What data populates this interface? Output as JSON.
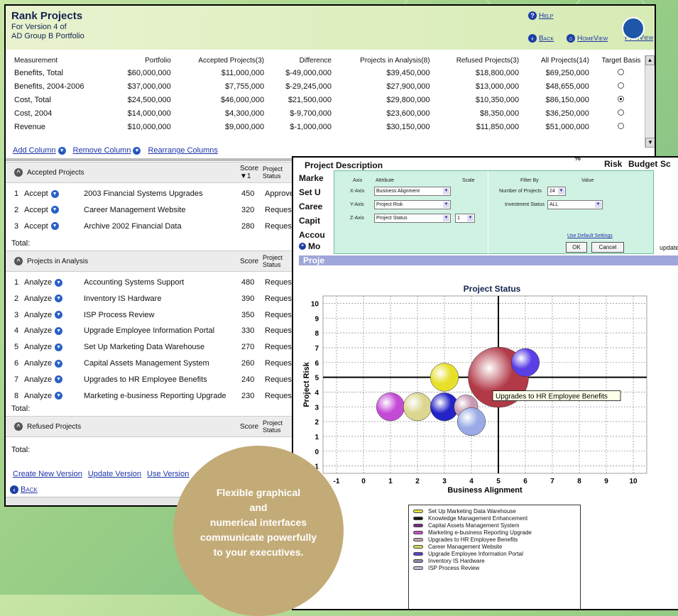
{
  "rank_window": {
    "title": "Rank Projects",
    "subtitle_line1": "For Version 4 of",
    "subtitle_line2": "AD Group B Portfolio",
    "help": "Help",
    "back": "Back",
    "homeview": "HomeView",
    "planview": "PlanView",
    "measurements": {
      "columns": [
        "Measurement",
        "Portfolio",
        "Accepted Projects(3)",
        "Difference",
        "Projects in Analysis(8)",
        "Refused Projects(3)",
        "All Projects(14)",
        "Target Basis"
      ],
      "rows": [
        {
          "name": "Benefits, Total",
          "portfolio": "$60,000,000",
          "accepted": "$11,000,000",
          "difference": "$-49,000,000",
          "analysis": "$39,450,000",
          "refused": "$18,800,000",
          "all": "$69,250,000",
          "target": false
        },
        {
          "name": "Benefits, 2004-2006",
          "portfolio": "$37,000,000",
          "accepted": "$7,755,000",
          "difference": "$-29,245,000",
          "analysis": "$27,900,000",
          "refused": "$13,000,000",
          "all": "$48,655,000",
          "target": false
        },
        {
          "name": "Cost, Total",
          "portfolio": "$24,500,000",
          "accepted": "$46,000,000",
          "difference": "$21,500,000",
          "analysis": "$29,800,000",
          "refused": "$10,350,000",
          "all": "$86,150,000",
          "target": true
        },
        {
          "name": "Cost, 2004",
          "portfolio": "$14,000,000",
          "accepted": "$4,300,000",
          "difference": "$-9,700,000",
          "analysis": "$23,600,000",
          "refused": "$8,350,000",
          "all": "$36,250,000",
          "target": false
        },
        {
          "name": "Revenue",
          "portfolio": "$10,000,000",
          "accepted": "$9,000,000",
          "difference": "$-1,000,000",
          "analysis": "$30,150,000",
          "refused": "$11,850,000",
          "all": "$51,000,000",
          "target": false
        }
      ]
    },
    "column_links": {
      "add": "Add Column",
      "remove": "Remove Column",
      "rearrange": "Rearrange Columns"
    },
    "accepted": {
      "header": "Accepted Projects",
      "score_label": "Score",
      "status_label_1": "Project",
      "status_label_2": "Status",
      "rows": [
        {
          "num": "1",
          "action": "Accept",
          "name": "2003 Financial Systems Upgrades",
          "score": "450",
          "status": "Approved"
        },
        {
          "num": "2",
          "action": "Accept",
          "name": "Career Management Website",
          "score": "320",
          "status": "Requested"
        },
        {
          "num": "3",
          "action": "Accept",
          "name": "Archive 2002 Financial Data",
          "score": "280",
          "status": "Requested"
        }
      ],
      "total": "Total:"
    },
    "analysis": {
      "header": "Projects in Analysis",
      "score_label": "Score",
      "status_label_1": "Project",
      "status_label_2": "Status",
      "rows": [
        {
          "num": "1",
          "action": "Analyze",
          "name": "Accounting Systems Support",
          "score": "480",
          "status": "Requested"
        },
        {
          "num": "2",
          "action": "Analyze",
          "name": "Inventory IS Hardware",
          "score": "390",
          "status": "Requested"
        },
        {
          "num": "3",
          "action": "Analyze",
          "name": "ISP Process Review",
          "score": "350",
          "status": "Requested"
        },
        {
          "num": "4",
          "action": "Analyze",
          "name": "Upgrade Employee Information Portal",
          "score": "330",
          "status": "Requested"
        },
        {
          "num": "5",
          "action": "Analyze",
          "name": "Set Up Marketing Data Warehouse",
          "score": "270",
          "status": "Requested"
        },
        {
          "num": "6",
          "action": "Analyze",
          "name": "Capital Assets Management System",
          "score": "260",
          "status": "Requested"
        },
        {
          "num": "7",
          "action": "Analyze",
          "name": "Upgrades to HR Employee Benefits",
          "score": "240",
          "status": "Requested"
        },
        {
          "num": "8",
          "action": "Analyze",
          "name": "Marketing e-business Reporting Upgrade",
          "score": "230",
          "status": "Requested"
        }
      ],
      "total": "Total:"
    },
    "refused": {
      "header": "Refused Projects",
      "score_label": "Score",
      "status_label_1": "Project",
      "status_label_2": "Status",
      "total": "Total:"
    },
    "bottom_links": {
      "create": "Create New Version",
      "update": "Update Version",
      "use": "Use Version"
    },
    "bottom_back": "Back"
  },
  "chart_window": {
    "col_project_description": "Project Description",
    "col_pct": "%",
    "col_risk": "Risk",
    "col_budget": "Budget",
    "col_sc": "Sc",
    "left_labels": [
      "Marke",
      "Set U",
      "Caree",
      "Capit",
      "Accou",
      "Mo"
    ],
    "bar_label": "Proje",
    "update_text": "update",
    "filter": {
      "axis_hdr": "Axis",
      "attr_hdr": "Attribute",
      "scale_hdr": "Scale",
      "x_axis": "X-Axis",
      "x_attr": "Business Alignment",
      "y_axis": "Y-Axis",
      "y_attr": "Project Risk",
      "z_axis": "Z-Axis",
      "z_attr": "Project Status",
      "z_scale": "1",
      "filterby_hdr": "Filter By",
      "value_hdr": "Value",
      "num_projects_label": "Number of Projects",
      "num_projects": "24",
      "inv_status_label": "Investment Status",
      "inv_status": "ALL",
      "default_link": "Use Default Settings",
      "ok": "OK",
      "cancel": "Cancel"
    },
    "tooltip": "Upgrades to HR Employee Benefits",
    "legend_items": [
      {
        "label": "Set Up Marketing Data Warehouse",
        "color": "#e8e23a"
      },
      {
        "label": "Knowledge Management Enhancement",
        "color": "#1a1a1a"
      },
      {
        "label": "Capital Assets Management System",
        "color": "#7a2a82"
      },
      {
        "label": "Marketing e-business Reporting Upgrade",
        "color": "#c850c8"
      },
      {
        "label": "Upgrades to HR Employee Benefits",
        "color": "#c8a0b4"
      },
      {
        "label": "Career Management Website",
        "color": "#d8d860"
      },
      {
        "label": "Upgrade Employee Information Portal",
        "color": "#5a3ed6"
      },
      {
        "label": "Inventory IS Hardware",
        "color": "#8c8caa"
      },
      {
        "label": "ISP Process Review",
        "color": "#b4c0d8"
      }
    ]
  },
  "chart_data": {
    "type": "scatter",
    "title": "Project Status",
    "xlabel": "Business Alignment",
    "ylabel": "Project Risk",
    "xlim": [
      -1.5,
      10.5
    ],
    "ylim": [
      -1.5,
      10.5
    ],
    "xticks": [
      "-1",
      "0",
      "1",
      "2",
      "3",
      "4",
      "5",
      "6",
      "7",
      "8",
      "9",
      "10"
    ],
    "yticks": [
      "10",
      "9",
      "8",
      "7",
      "6",
      "5",
      "4",
      "3",
      "2",
      "1",
      "0",
      "-1"
    ],
    "crosshair": {
      "x": 5,
      "y": 5
    },
    "grid": true,
    "points": [
      {
        "x": 1,
        "y": 3,
        "z": 1.0,
        "color": "#c44bd6"
      },
      {
        "x": 2,
        "y": 3,
        "z": 1.0,
        "color": "#dcd690"
      },
      {
        "x": 3,
        "y": 5,
        "z": 1.0,
        "color": "#e6e02a"
      },
      {
        "x": 3,
        "y": 3,
        "z": 1.0,
        "color": "#2323c8"
      },
      {
        "x": 3.8,
        "y": 3,
        "z": 0.85,
        "color": "#c89ab4"
      },
      {
        "x": 4,
        "y": 2,
        "z": 1.0,
        "color": "#9aaae6"
      },
      {
        "x": 5,
        "y": 5,
        "z": 2.15,
        "color": "#b23a48"
      },
      {
        "x": 6,
        "y": 6,
        "z": 1.0,
        "color": "#5a3ee6"
      }
    ]
  },
  "callout": {
    "text": "Flexible graphical\nand\nnumerical interfaces\ncommunicate powerfully\nto your executives."
  },
  "colors": {
    "link": "#1d34a6",
    "header_bg": "#e9f3cf",
    "background": "#9ccf86",
    "callout": "#c3ab77",
    "chart_bar": "#9fa6d9",
    "filter_bg": "#d0f2e2"
  }
}
